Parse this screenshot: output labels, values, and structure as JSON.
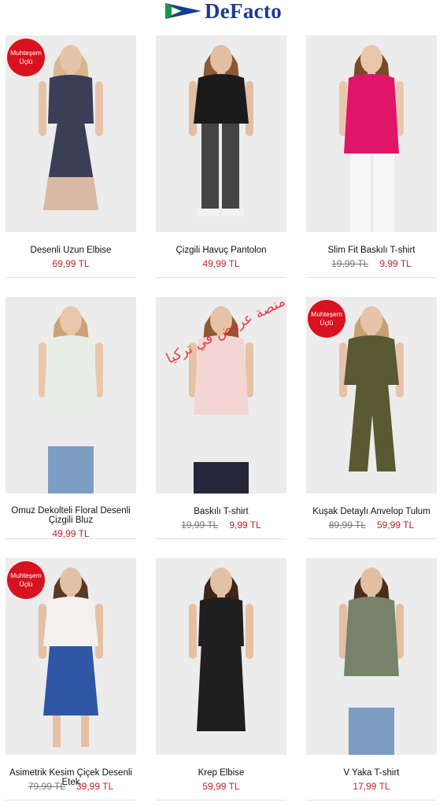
{
  "brand": {
    "name": "DeFacto",
    "logo_color": "#1d3a8c",
    "mark_colors": [
      "#1d3a8c",
      "#1a9a48"
    ]
  },
  "badge_text": [
    "Muhteşem",
    "Üçlü"
  ],
  "watermark": "منصة عروض في تركيا",
  "colors": {
    "price": "#c8202a",
    "badge": "#d8121f",
    "old_price": "#777777"
  },
  "products": [
    {
      "name": "Desenli Uzun Elbise",
      "old_price": "",
      "price": "69,99 TL",
      "badge": true,
      "garment": "#3a3f57",
      "skin": "#e6c4aa",
      "hair": "#d8b88a",
      "legs": "maxi"
    },
    {
      "name": "Çizgili Havuç Pantolon",
      "old_price": "",
      "price": "49,99 TL",
      "badge": false,
      "garment": "#1b1b1b",
      "skin": "#e2bea3",
      "hair": "#8b5a32",
      "legs": "pants"
    },
    {
      "name": "Slim Fit Baskılı T-shirt",
      "old_price": "19,99 TL",
      "price": "9,99 TL",
      "badge": false,
      "garment": "#e0156a",
      "skin": "#e9c7ad",
      "hair": "#7a4b2a",
      "legs": "white"
    },
    {
      "name": "Omuz Dekolteli Floral Desenli Çizgili Bluz",
      "old_price": "",
      "price": "49,99 TL",
      "badge": false,
      "garment": "#e9ede7",
      "skin": "#e9c7ad",
      "hair": "#caa277",
      "legs": "jeans"
    },
    {
      "name": "Baskılı T-shirt",
      "old_price": "19,99 TL",
      "price": "9,99 TL",
      "badge": false,
      "garment": "#f3d6d4",
      "skin": "#e6c2a6",
      "hair": "#8a5a34",
      "legs": "floral"
    },
    {
      "name": "Kuşak Detaylı Anvelop Tulum",
      "old_price": "89,99 TL",
      "price": "59,99 TL",
      "badge": true,
      "garment": "#5a5a32",
      "skin": "#e6c4aa",
      "hair": "#c9a071",
      "legs": "jumpsuit"
    },
    {
      "name": "Asimetrik Kesim Çiçek Desenli Etek",
      "old_price": "79,99 TL",
      "price": "39,99 TL",
      "badge": true,
      "garment": "#f3f1ee",
      "skin": "#e4c0a4",
      "hair": "#5a3a22",
      "legs": "skirt"
    },
    {
      "name": "Krep Elbise",
      "old_price": "",
      "price": "59,99 TL",
      "badge": false,
      "garment": "#1f1f1f",
      "skin": "#e4c0a4",
      "hair": "#3c2618",
      "legs": "dress"
    },
    {
      "name": "V Yaka T-shirt",
      "old_price": "",
      "price": "17,99 TL",
      "badge": false,
      "garment": "#76836a",
      "skin": "#e2bea3",
      "hair": "#4a2e1c",
      "legs": "jeans"
    }
  ]
}
